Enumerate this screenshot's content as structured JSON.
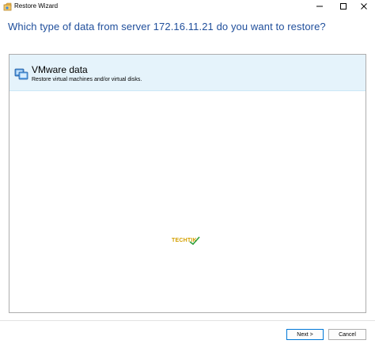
{
  "window": {
    "title": "Restore Wizard",
    "icon": "restore-wizard-icon",
    "controls": [
      "minimize-icon",
      "maximize-icon",
      "close-icon"
    ]
  },
  "heading": "Which type of data from server 172.16.11.21 do you want to restore?",
  "list": {
    "items": [
      {
        "icon": "vmware-icon",
        "title": "VMware data",
        "description": "Restore virtual machines and/or virtual disks."
      }
    ]
  },
  "watermark": {
    "text": "TECHTIK"
  },
  "footer": {
    "next_label": "Next >",
    "cancel_label": "Cancel"
  },
  "colors": {
    "heading": "#1f4e9b",
    "selection_bg": "#e5f3fb",
    "default_button_border": "#0078d7"
  }
}
